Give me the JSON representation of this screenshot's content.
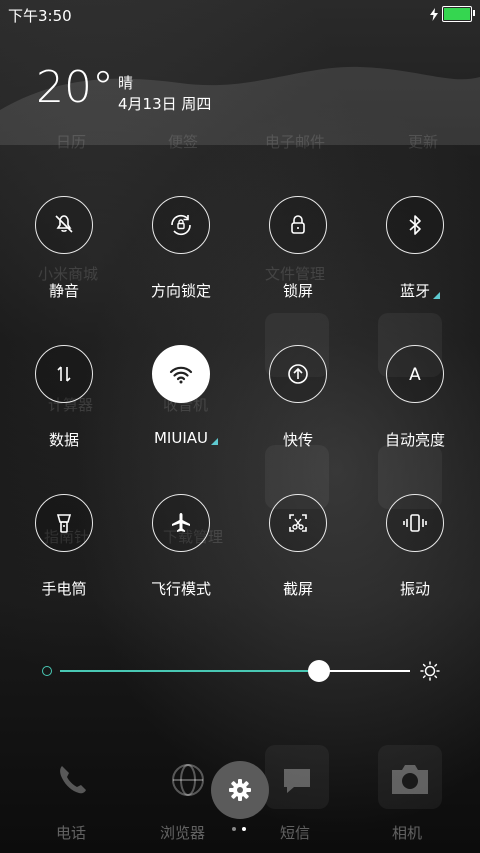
{
  "status_bar": {
    "time": "下午3:50",
    "battery_level": 1.0
  },
  "weather": {
    "temperature": "20°",
    "condition": "晴",
    "date": "4月13日 周四"
  },
  "background_labels": {
    "row1": [
      "日历",
      "便签",
      "电子邮件",
      "更新"
    ],
    "row2": [
      "小米商城",
      "文件管理"
    ],
    "row3": [
      "计算器",
      "收音机"
    ],
    "row4": [
      "指南针",
      "下载管理"
    ]
  },
  "toggles": [
    {
      "id": "mute",
      "label": "静音",
      "active": false,
      "icon": "bell-off-icon",
      "has_more": false
    },
    {
      "id": "rotation-lock",
      "label": "方向锁定",
      "active": false,
      "icon": "rotation-lock-icon",
      "has_more": false
    },
    {
      "id": "lock-screen",
      "label": "锁屏",
      "active": false,
      "icon": "lock-icon",
      "has_more": false
    },
    {
      "id": "bluetooth",
      "label": "蓝牙",
      "active": false,
      "icon": "bluetooth-icon",
      "has_more": true
    },
    {
      "id": "data",
      "label": "数据",
      "active": false,
      "icon": "data-arrows-icon",
      "has_more": false
    },
    {
      "id": "wifi",
      "label": "MIUIAU",
      "active": true,
      "icon": "wifi-icon",
      "has_more": true
    },
    {
      "id": "quick-send",
      "label": "快传",
      "active": false,
      "icon": "quick-send-icon",
      "has_more": false
    },
    {
      "id": "auto-brightness",
      "label": "自动亮度",
      "active": false,
      "icon": "auto-brightness-icon",
      "has_more": false
    },
    {
      "id": "flashlight",
      "label": "手电筒",
      "active": false,
      "icon": "flashlight-icon",
      "has_more": false
    },
    {
      "id": "airplane",
      "label": "飞行模式",
      "active": false,
      "icon": "airplane-icon",
      "has_more": false
    },
    {
      "id": "screenshot",
      "label": "截屏",
      "active": false,
      "icon": "screenshot-icon",
      "has_more": false
    },
    {
      "id": "vibrate",
      "label": "振动",
      "active": false,
      "icon": "vibrate-icon",
      "has_more": false
    }
  ],
  "brightness": {
    "value": 0.74,
    "accent": "#49c8b4"
  },
  "auto_brightness_glyph": "A",
  "dock": {
    "labels": [
      "电话",
      "浏览器",
      "短信",
      "相机"
    ]
  },
  "pager": {
    "pages": 2,
    "active": 1
  }
}
